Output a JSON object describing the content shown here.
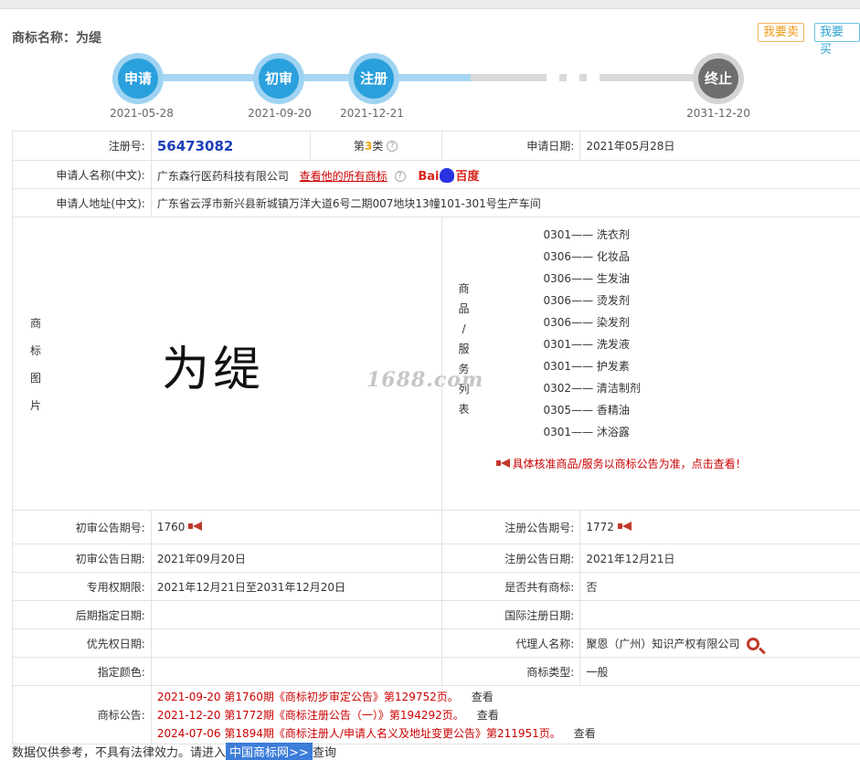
{
  "header": {
    "title": "商标名称：为缇",
    "sell_label": "我要卖",
    "buy_label": "我要买"
  },
  "progress": {
    "steps": [
      {
        "label": "申请",
        "date": "2021-05-28"
      },
      {
        "label": "初审",
        "date": "2021-09-20"
      },
      {
        "label": "注册",
        "date": "2021-12-21"
      },
      {
        "label": "终止",
        "date": "2031-12-20"
      }
    ]
  },
  "info": {
    "reg_no_label": "注册号:",
    "reg_no": "56473082",
    "class_prefix": "第",
    "class_num": "3",
    "class_suffix": "类",
    "apply_date_label": "申请日期:",
    "apply_date": "2021年05月28日",
    "applicant_label": "申请人名称(中文):",
    "applicant": "广东森行医药科技有限公司",
    "applicant_link": "查看他的所有商标",
    "baidu_left": "Bai",
    "baidu_right": "百度",
    "address_label": "申请人地址(中文):",
    "address": "广东省云浮市新兴县新城镇万洋大道6号二期007地块13幢101-301号生产车间",
    "image_label": [
      "商",
      "标",
      "图",
      "片"
    ],
    "tm_image_text": "为缇",
    "goods_label": [
      "商",
      "品",
      "/",
      "服",
      "务",
      "列",
      "表"
    ],
    "goods": [
      {
        "code": "0301",
        "name": "洗衣剂"
      },
      {
        "code": "0306",
        "name": "化妆品"
      },
      {
        "code": "0306",
        "name": "生发油"
      },
      {
        "code": "0306",
        "name": "烫发剂"
      },
      {
        "code": "0306",
        "name": "染发剂"
      },
      {
        "code": "0301",
        "name": "洗发液"
      },
      {
        "code": "0301",
        "name": "护发素"
      },
      {
        "code": "0302",
        "name": "清洁制剂"
      },
      {
        "code": "0305",
        "name": "香精油"
      },
      {
        "code": "0301",
        "name": "沐浴露"
      }
    ],
    "goods_note": "具体核准商品/服务以商标公告为准，点击查看！",
    "watermark": "1688.com",
    "prelim_no_label": "初审公告期号:",
    "prelim_no": "1760",
    "reg_notice_no_label": "注册公告期号:",
    "reg_notice_no": "1772",
    "prelim_date_label": "初审公告日期:",
    "prelim_date": "2021年09月20日",
    "reg_notice_date_label": "注册公告日期:",
    "reg_notice_date": "2021年12月21日",
    "exclusive_label": "专用权期限:",
    "exclusive": "2021年12月21日至2031年12月20日",
    "shared_label": "是否共有商标:",
    "shared": "否",
    "later_label": "后期指定日期:",
    "later": "",
    "intl_label": "国际注册日期:",
    "intl": "",
    "priority_label": "优先权日期:",
    "priority": "",
    "agent_label": "代理人名称:",
    "agent": "聚恩（广州）知识产权有限公司",
    "color_label": "指定颜色:",
    "color": "",
    "type_label": "商标类型:",
    "type": "一般",
    "notice_label": "商标公告:",
    "notices": [
      {
        "text": "2021-09-20 第1760期《商标初步审定公告》第129752页。",
        "view": "查看"
      },
      {
        "text": "2021-12-20 第1772期《商标注册公告（一）》第194292页。",
        "view": "查看"
      },
      {
        "text": "2024-07-06 第1894期《商标注册人/申请人名义及地址变更公告》第211951页。",
        "view": "查看"
      }
    ]
  },
  "footer": {
    "text": "数据仅供参考，不具有法律效力。请进入",
    "link": "中国商标网>>",
    "after": "查询"
  },
  "colors": {
    "accent_blue": "#2aa0dc",
    "reg_no": "#1b3fb8",
    "link_red": "#cc0000",
    "sell": "#f29a17",
    "buy": "#2ba3d1"
  }
}
